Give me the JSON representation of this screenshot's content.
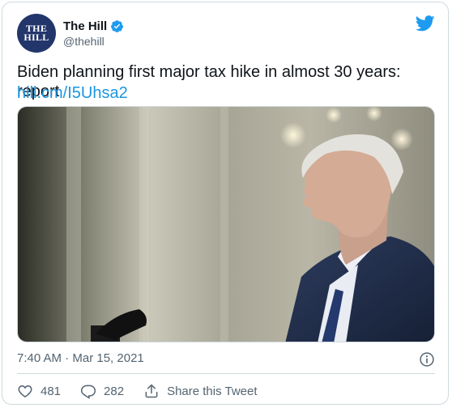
{
  "account": {
    "name": "The Hill",
    "handle": "@thehill",
    "avatar_line1": "THE",
    "avatar_line2": "HILL"
  },
  "tweet": {
    "text": "Biden planning first major tax hike in almost 30 years: report",
    "link_text": "hill.cm/I5Uhsa2",
    "timestamp": "7:40 AM · Mar 15, 2021"
  },
  "actions": {
    "likes": "481",
    "replies": "282",
    "share_label": "Share this Tweet"
  },
  "colors": {
    "accent": "#1b95e0",
    "verified": "#1d9bf0",
    "secondary_text": "#536471",
    "avatar_bg": "#23366b"
  },
  "icons": [
    "verified-badge-icon",
    "twitter-bird-icon",
    "info-icon",
    "heart-icon",
    "reply-icon",
    "share-icon"
  ]
}
